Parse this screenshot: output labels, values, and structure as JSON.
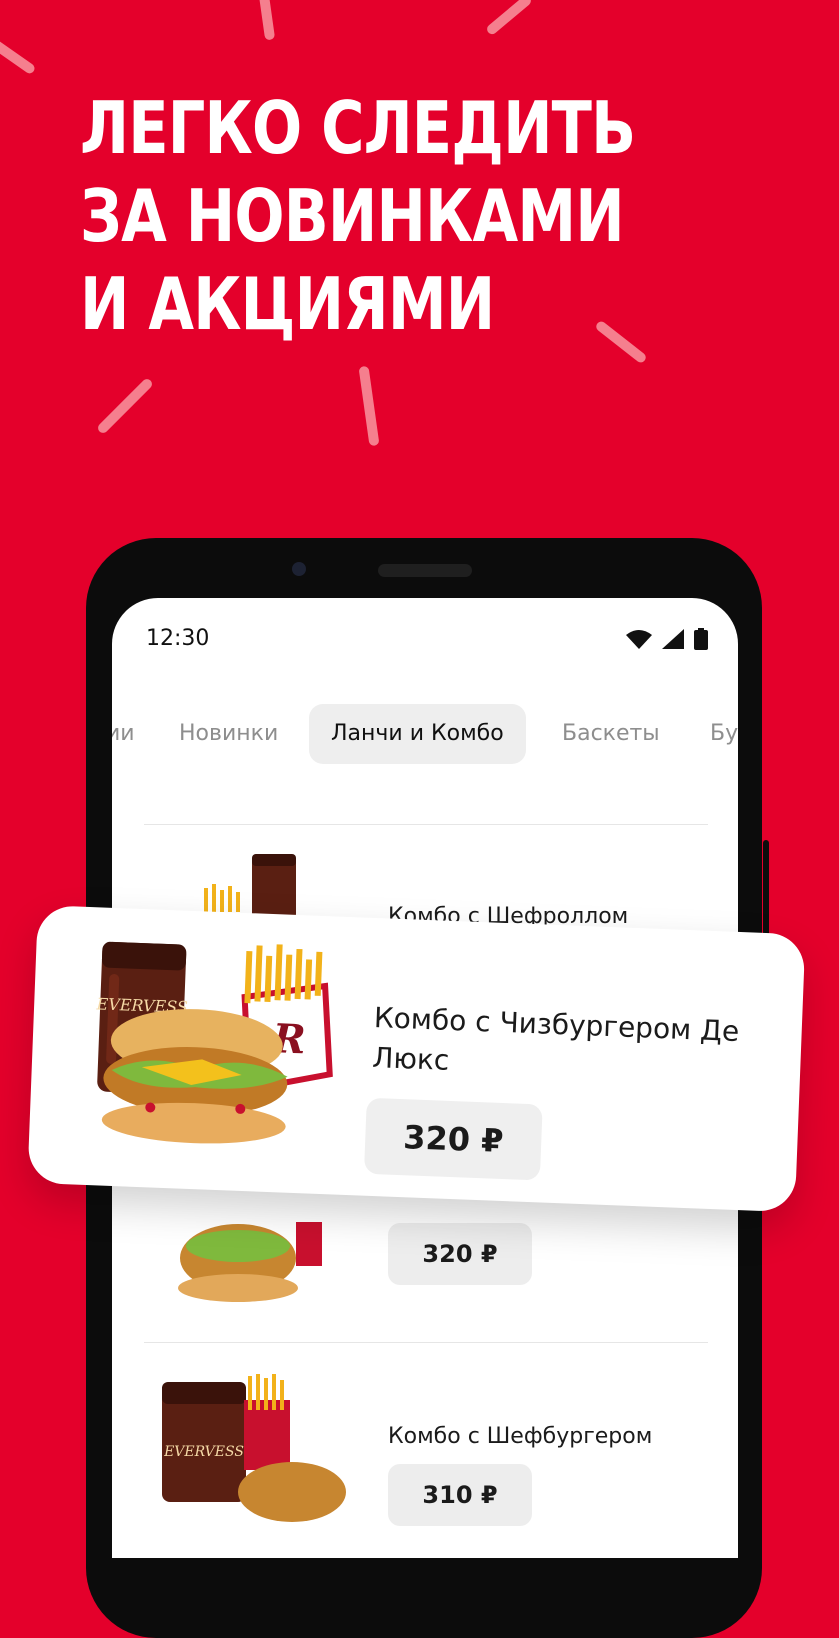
{
  "headline": {
    "lines": [
      "ЛЕГКО СЛЕДИТЬ",
      "ЗА НОВИНКАМИ",
      "И АКЦИЯМИ"
    ]
  },
  "colors": {
    "brand_red": "#e4002b",
    "confetti": "#f57f8e"
  },
  "status_bar": {
    "time": "12:30",
    "icons": [
      "wifi-icon",
      "signal-icon",
      "battery-icon"
    ]
  },
  "tabs": [
    {
      "label": "ии",
      "active": false
    },
    {
      "label": "Новинки",
      "active": false
    },
    {
      "label": "Ланчи и Комбо",
      "active": true
    },
    {
      "label": "Баскеты",
      "active": false
    },
    {
      "label": "Бу",
      "active": false
    }
  ],
  "menu": {
    "items": [
      {
        "title": "Комбо с Шефроллом",
        "price": ""
      },
      {
        "title": "",
        "price": "320 ₽"
      },
      {
        "title": "Комбо с Шефбургером",
        "price": "310 ₽"
      }
    ]
  },
  "featured": {
    "title": "Комбо с Чизбургером Де Люкс",
    "price": "320 ₽",
    "cup_label": "EVERVESS"
  }
}
